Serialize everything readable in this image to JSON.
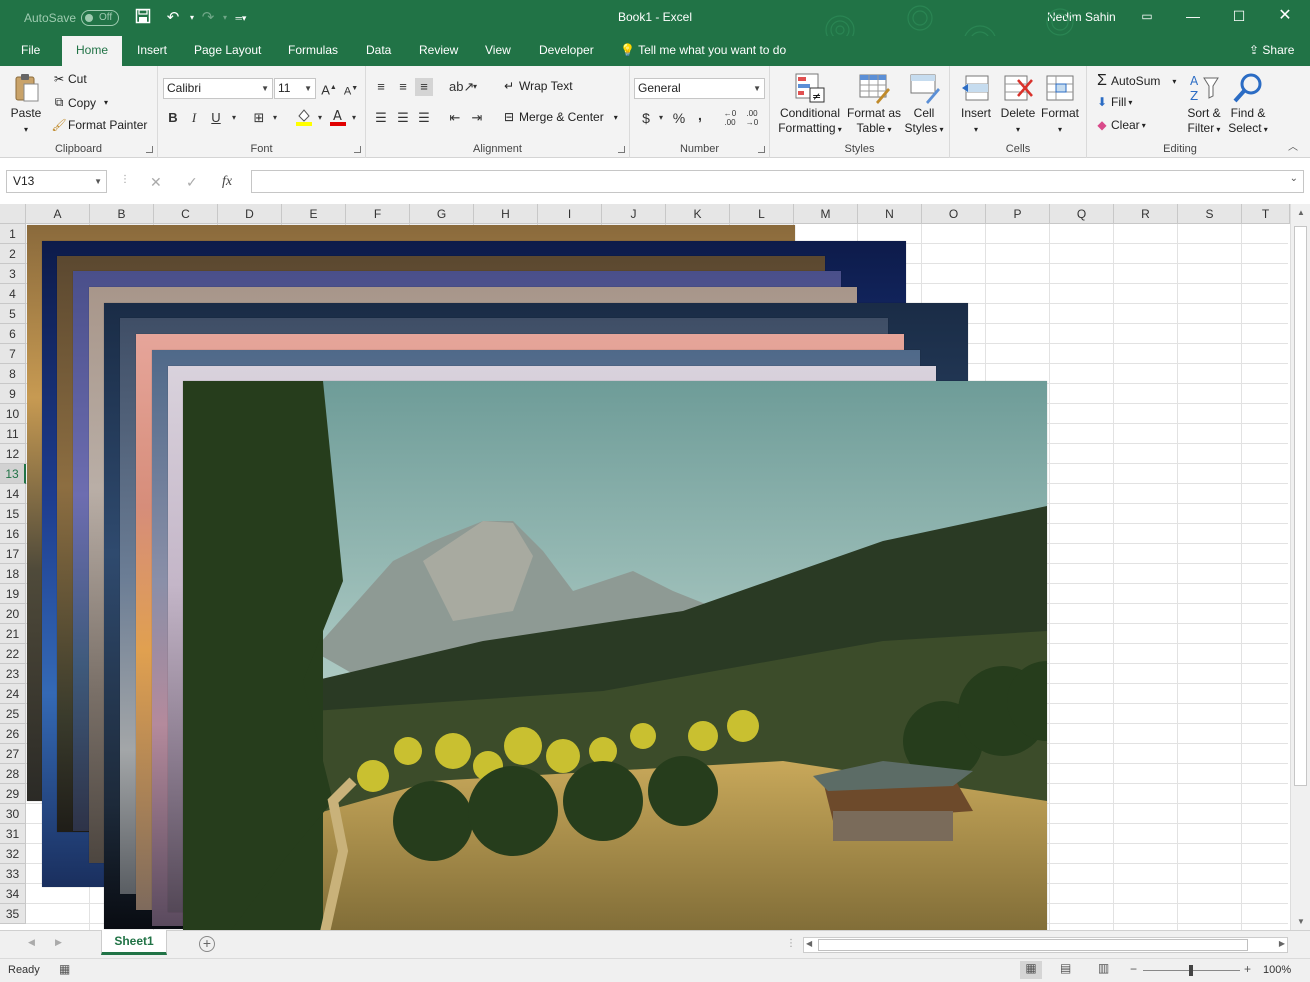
{
  "titlebar": {
    "autosave_label": "AutoSave",
    "autosave_state": "Off",
    "doc_title": "Book1  -  Excel",
    "user_name": "Nedim Sahin"
  },
  "tabs": [
    {
      "label": "File"
    },
    {
      "label": "Home"
    },
    {
      "label": "Insert"
    },
    {
      "label": "Page Layout"
    },
    {
      "label": "Formulas"
    },
    {
      "label": "Data"
    },
    {
      "label": "Review"
    },
    {
      "label": "View"
    },
    {
      "label": "Developer"
    }
  ],
  "tell_me": "Tell me what you want to do",
  "share": "Share",
  "ribbon": {
    "clipboard": {
      "label": "Clipboard",
      "paste": "Paste",
      "cut": "Cut",
      "copy": "Copy",
      "format_painter": "Format Painter"
    },
    "font": {
      "label": "Font",
      "font_name": "Calibri",
      "font_size": "11",
      "bold": "B",
      "italic": "I",
      "underline": "U"
    },
    "alignment": {
      "label": "Alignment",
      "wrap_text": "Wrap Text",
      "merge_center": "Merge & Center"
    },
    "number": {
      "label": "Number",
      "format": "General",
      "currency": "$",
      "percent": "%",
      "comma": ","
    },
    "styles": {
      "label": "Styles",
      "conditional_1": "Conditional",
      "conditional_2": "Formatting",
      "format_table_1": "Format as",
      "format_table_2": "Table",
      "cell_styles_1": "Cell",
      "cell_styles_2": "Styles"
    },
    "cells": {
      "label": "Cells",
      "insert": "Insert",
      "delete": "Delete",
      "format": "Format"
    },
    "editing": {
      "label": "Editing",
      "autosum": "AutoSum",
      "fill": "Fill",
      "clear": "Clear",
      "sort_1": "Sort &",
      "sort_2": "Filter",
      "find_1": "Find &",
      "find_2": "Select"
    }
  },
  "formula_bar": {
    "name_box": "V13",
    "fx": "fx",
    "value": ""
  },
  "columns": [
    "A",
    "B",
    "C",
    "D",
    "E",
    "F",
    "G",
    "H",
    "I",
    "J",
    "K",
    "L",
    "M",
    "N",
    "O",
    "P",
    "Q",
    "R",
    "S",
    "T"
  ],
  "rows": [
    "1",
    "2",
    "3",
    "4",
    "5",
    "6",
    "7",
    "8",
    "9",
    "10",
    "11",
    "12",
    "13",
    "14",
    "15",
    "16",
    "17",
    "18",
    "19",
    "20",
    "21",
    "22",
    "23",
    "24",
    "25",
    "26",
    "27",
    "28",
    "29",
    "30",
    "31",
    "32",
    "33",
    "34",
    "35"
  ],
  "selected_row": "13",
  "sheets": [
    {
      "name": "Sheet1"
    }
  ],
  "status": {
    "ready": "Ready",
    "zoom": "100%"
  },
  "colors": {
    "accent": "#217346"
  }
}
